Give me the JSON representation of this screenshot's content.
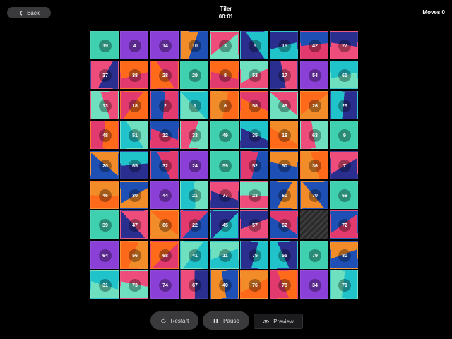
{
  "header": {
    "back_label": "Back",
    "title": "Tiler",
    "timer": "00:01",
    "moves": "Moves 0"
  },
  "board": {
    "rows": 9,
    "cols": 9,
    "tiles": [
      [
        19,
        4,
        14,
        10,
        3,
        5,
        15,
        42,
        27
      ],
      [
        37,
        38,
        28,
        29,
        8,
        53,
        17,
        54,
        61
      ],
      [
        13,
        18,
        2,
        1,
        6,
        58,
        43,
        26,
        25
      ],
      [
        48,
        51,
        12,
        33,
        49,
        35,
        16,
        63,
        9
      ],
      [
        20,
        65,
        32,
        24,
        59,
        52,
        50,
        36,
        7
      ],
      [
        46,
        30,
        44,
        21,
        77,
        23,
        60,
        70,
        69
      ],
      [
        39,
        47,
        66,
        22,
        45,
        57,
        62,
        null,
        72
      ],
      [
        64,
        56,
        68,
        41,
        11,
        75,
        55,
        79,
        80
      ],
      [
        31,
        73,
        74,
        67,
        40,
        76,
        78,
        34,
        71
      ]
    ],
    "palette": [
      "#f28c28",
      "#6ee0c0",
      "#1e4fb5",
      "#ee4d7b",
      "#8a3fd6",
      "#20c3c9",
      "#ff6a1a",
      "#2a2f8f",
      "#e23a6e",
      "#3fd0b0"
    ]
  },
  "controls": {
    "restart_label": "Restart",
    "pause_label": "Pause",
    "preview_label": "Preview"
  }
}
